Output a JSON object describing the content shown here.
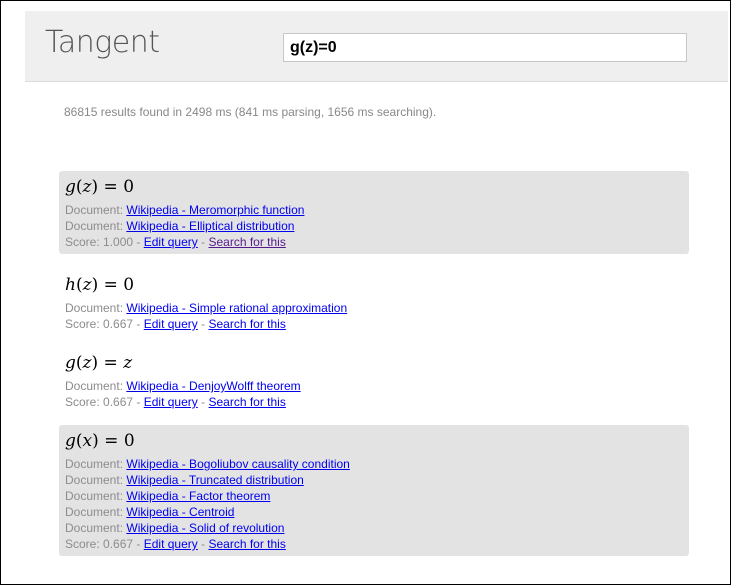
{
  "app": {
    "title": "Tangent"
  },
  "search": {
    "value": "g(z)=0"
  },
  "results_info": "86815 results found in 2498 ms (841 ms parsing, 1656 ms searching).",
  "labels": {
    "document": "Document:",
    "score_prefix": "Score:",
    "separator": "-",
    "edit_query": "Edit query",
    "search_for_this": "Search for this"
  },
  "results": [
    {
      "formula": {
        "func": "g",
        "var": "z",
        "rhs": "0"
      },
      "documents": [
        "Wikipedia - Meromorphic function",
        "Wikipedia - Elliptical distribution"
      ],
      "score": "1.000",
      "shaded": true
    },
    {
      "formula": {
        "func": "h",
        "var": "z",
        "rhs": "0"
      },
      "documents": [
        "Wikipedia - Simple rational approximation"
      ],
      "score": "0.667",
      "shaded": false
    },
    {
      "formula": {
        "func": "g",
        "var": "z",
        "rhs": "z"
      },
      "documents": [
        "Wikipedia - DenjoyWolff theorem"
      ],
      "score": "0.667",
      "shaded": false
    },
    {
      "formula": {
        "func": "g",
        "var": "x",
        "rhs": "0"
      },
      "documents": [
        "Wikipedia - Bogoliubov causality condition",
        "Wikipedia - Truncated distribution",
        "Wikipedia - Factor theorem",
        "Wikipedia - Centroid",
        "Wikipedia - Solid of revolution"
      ],
      "score": "0.667",
      "shaded": true
    }
  ],
  "colors": {
    "header_bg": "#efefef",
    "shaded_bg": "#e3e3e3",
    "link": "#0000ee",
    "visited_link": "#551a8b",
    "muted_text": "#8c8c8c"
  }
}
